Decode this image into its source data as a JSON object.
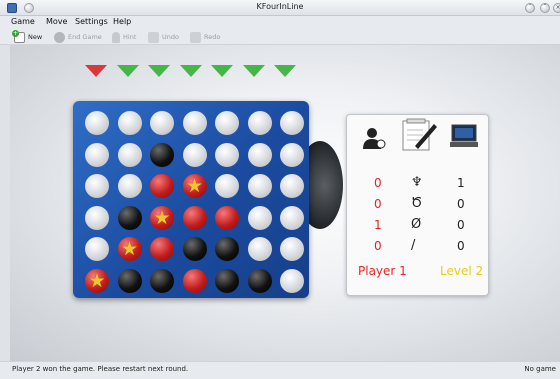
{
  "window": {
    "title": "KFourInLine"
  },
  "menu": [
    "Game",
    "Move",
    "Settings",
    "Help"
  ],
  "toolbar": {
    "new": "New",
    "end_game": "End Game",
    "hint": "Hint",
    "undo": "Undo",
    "redo": "Redo"
  },
  "column_markers": [
    "red",
    "green",
    "green",
    "green",
    "green",
    "green",
    "green"
  ],
  "board": {
    "rows": [
      [
        "empty",
        "empty",
        "empty",
        "empty",
        "empty",
        "empty",
        "empty"
      ],
      [
        "empty",
        "empty",
        "black",
        "empty",
        "empty",
        "empty",
        "empty"
      ],
      [
        "empty",
        "empty",
        "red",
        "red-star",
        "empty",
        "empty",
        "empty"
      ],
      [
        "empty",
        "black",
        "red-star",
        "red",
        "red",
        "empty",
        "empty"
      ],
      [
        "empty",
        "red-star",
        "red",
        "black",
        "black",
        "empty",
        "empty"
      ],
      [
        "red-star",
        "black",
        "black",
        "red",
        "black",
        "black",
        "empty"
      ]
    ]
  },
  "scores": {
    "rows": [
      {
        "icon": "trophy-icon",
        "symbol": "♆",
        "red": "0",
        "black": "1"
      },
      {
        "icon": "loss-icon",
        "symbol": "Ծ",
        "red": "0",
        "black": "0"
      },
      {
        "icon": "aborted-icon",
        "symbol": "Ø",
        "red": "1",
        "black": "0"
      },
      {
        "icon": "draw-icon",
        "symbol": "/",
        "red": "0",
        "black": "0"
      }
    ],
    "player": "Player 1",
    "level": "Level 2"
  },
  "statusbar": {
    "message": "Player 2 won the game. Please restart next round.",
    "right": "No game"
  },
  "colors": {
    "board": "#1b4ba0",
    "red_player": "#e02424",
    "level": "#e8cc1c"
  }
}
